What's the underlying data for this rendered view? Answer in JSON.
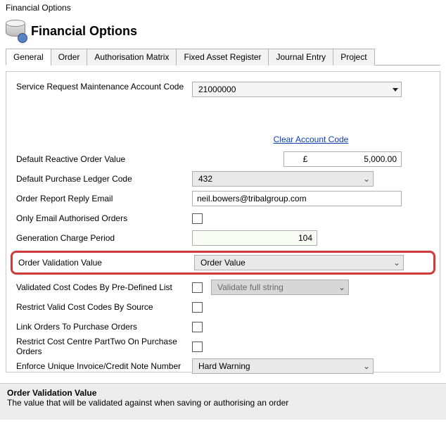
{
  "window_title": "Financial Options",
  "header": {
    "title": "Financial Options"
  },
  "tabs": [
    "General",
    "Order",
    "Authorisation Matrix",
    "Fixed Asset Register",
    "Journal Entry",
    "Project"
  ],
  "active_tab": 0,
  "fields": {
    "service_request_label": "Service Request Maintenance Account Code",
    "service_request_value": "21000000",
    "clear_account_link": "Clear Account Code",
    "default_reactive_label": "Default Reactive Order Value",
    "default_reactive_currency": "£",
    "default_reactive_amount": "5,000.00",
    "default_ledger_label": "Default Purchase Ledger Code",
    "default_ledger_value": "432",
    "reply_email_label": "Order Report Reply Email",
    "reply_email_value": "neil.bowers@tribalgroup.com",
    "only_email_label": "Only Email Authorised Orders",
    "gen_charge_label": "Generation Charge Period",
    "gen_charge_value": "104",
    "validation_value_label": "Order Validation Value",
    "validation_value_selected": "Order Value",
    "validated_costcodes_label": "Validated Cost Codes By Pre-Defined List",
    "validate_full_string_label": "Validate full string",
    "restrict_valid_costcodes_label": "Restrict Valid Cost Codes By Source",
    "link_orders_label": "Link Orders To Purchase Orders",
    "restrict_costcentre_label": "Restrict Cost Centre PartTwo On Purchase Orders",
    "enforce_unique_label": "Enforce Unique Invoice/Credit Note Number",
    "enforce_unique_value": "Hard Warning"
  },
  "help": {
    "title": "Order Validation Value",
    "text": "The value that will be validated against when saving or authorising an order"
  }
}
